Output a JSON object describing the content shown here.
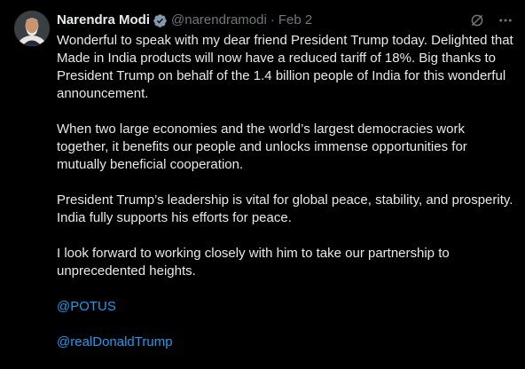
{
  "author": {
    "name": "Narendra Modi",
    "handle": "@narendramodi",
    "separator": "·",
    "date": "Feb 2"
  },
  "icons": {
    "verified": "verified-badge-icon",
    "grok": "grok-icon",
    "more": "more-icon"
  },
  "colors": {
    "background": "#000000",
    "text": "#e7e9ea",
    "secondary_text": "#71767b",
    "link": "#1d9bf0",
    "verified_badge": "#829aab"
  },
  "post": {
    "paragraphs": [
      "Wonderful to speak with my dear friend President Trump today. Delighted that Made in India products will now have a reduced tariff of 18%. Big thanks to President Trump on behalf of the 1.4 billion people of India for this wonderful announcement.",
      "When two large economies and the world’s largest democracies work together, it benefits our people and unlocks immense opportunities for mutually beneficial cooperation.",
      "President Trump’s leadership is vital for global peace, stability, and prosperity. India fully supports his efforts for peace.",
      "I look forward to working closely with him to take our partnership to unprecedented heights."
    ],
    "mentions": [
      "@POTUS",
      "@realDonaldTrump"
    ]
  }
}
